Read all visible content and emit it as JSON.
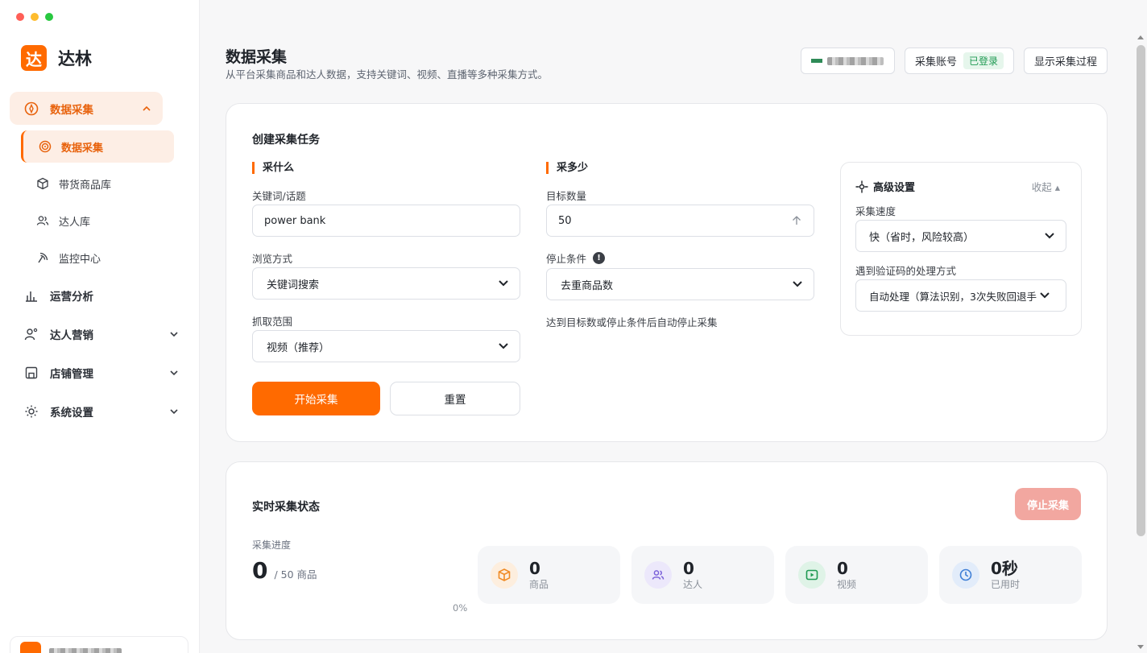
{
  "brand": {
    "logo_char": "达",
    "name": "达林"
  },
  "sidebar": {
    "groups": [
      {
        "label": "数据采集",
        "icon": "compass-icon",
        "expanded": true,
        "items": [
          {
            "label": "数据采集",
            "icon": "target-icon",
            "active": true
          },
          {
            "label": "带货商品库",
            "icon": "box-icon"
          },
          {
            "label": "达人库",
            "icon": "users-icon"
          },
          {
            "label": "监控中心",
            "icon": "radar-icon"
          }
        ]
      },
      {
        "label": "运营分析",
        "icon": "bar-chart-icon"
      },
      {
        "label": "达人营销",
        "icon": "user-star-icon"
      },
      {
        "label": "店铺管理",
        "icon": "store-icon"
      },
      {
        "label": "系统设置",
        "icon": "gear-icon"
      }
    ]
  },
  "header": {
    "title": "数据采集",
    "subtitle": "从平台采集商品和达人数据，支持关键词、视频、直播等多种采集方式。",
    "actions": {
      "account_label": "采集账号",
      "account_status": "已登录",
      "show_process": "显示采集过程"
    }
  },
  "create_task": {
    "title": "创建采集任务",
    "what_section": "采什么",
    "keyword_label": "关键词/话题",
    "keyword_value": "power bank",
    "browse_label": "浏览方式",
    "browse_value": "关键词搜索",
    "scope_label": "抓取范围",
    "scope_value": "视频（推荐）",
    "start_button": "开始采集",
    "reset_button": "重置",
    "how_many_section": "采多少",
    "target_label": "目标数量",
    "target_value": "50",
    "stop_label": "停止条件",
    "stop_value": "去重商品数",
    "stop_hint": "达到目标数或停止条件后自动停止采集",
    "advanced": {
      "title": "高级设置",
      "collapse": "收起 ▴",
      "speed_label": "采集速度",
      "speed_value": "快（省时，风险较高）",
      "captcha_label": "遇到验证码的处理方式",
      "captcha_value": "自动处理（算法识别，3次失败回退手"
    }
  },
  "status": {
    "title": "实时采集状态",
    "stop_button": "停止采集",
    "progress_label": "采集进度",
    "progress_value": "0",
    "progress_total": "/ 50 商品",
    "progress_percent": "0%",
    "stats": [
      {
        "value": "0",
        "label": "商品",
        "icon": "box-icon",
        "color": "#f08a24",
        "bg": "#fdeede"
      },
      {
        "value": "0",
        "label": "达人",
        "icon": "users-icon",
        "color": "#7b61d9",
        "bg": "#ece8fb"
      },
      {
        "value": "0",
        "label": "视频",
        "icon": "video-icon",
        "color": "#1f9a52",
        "bg": "#dff3e7"
      },
      {
        "value": "0秒",
        "label": "已用时",
        "icon": "clock-icon",
        "color": "#3f7fd6",
        "bg": "#e2ecfa"
      }
    ]
  },
  "colors": {
    "accent": "#ff6a00",
    "accent_soft": "#fdeee5",
    "success": "#1f9a52",
    "stop_disabled": "#f2a7a0"
  }
}
